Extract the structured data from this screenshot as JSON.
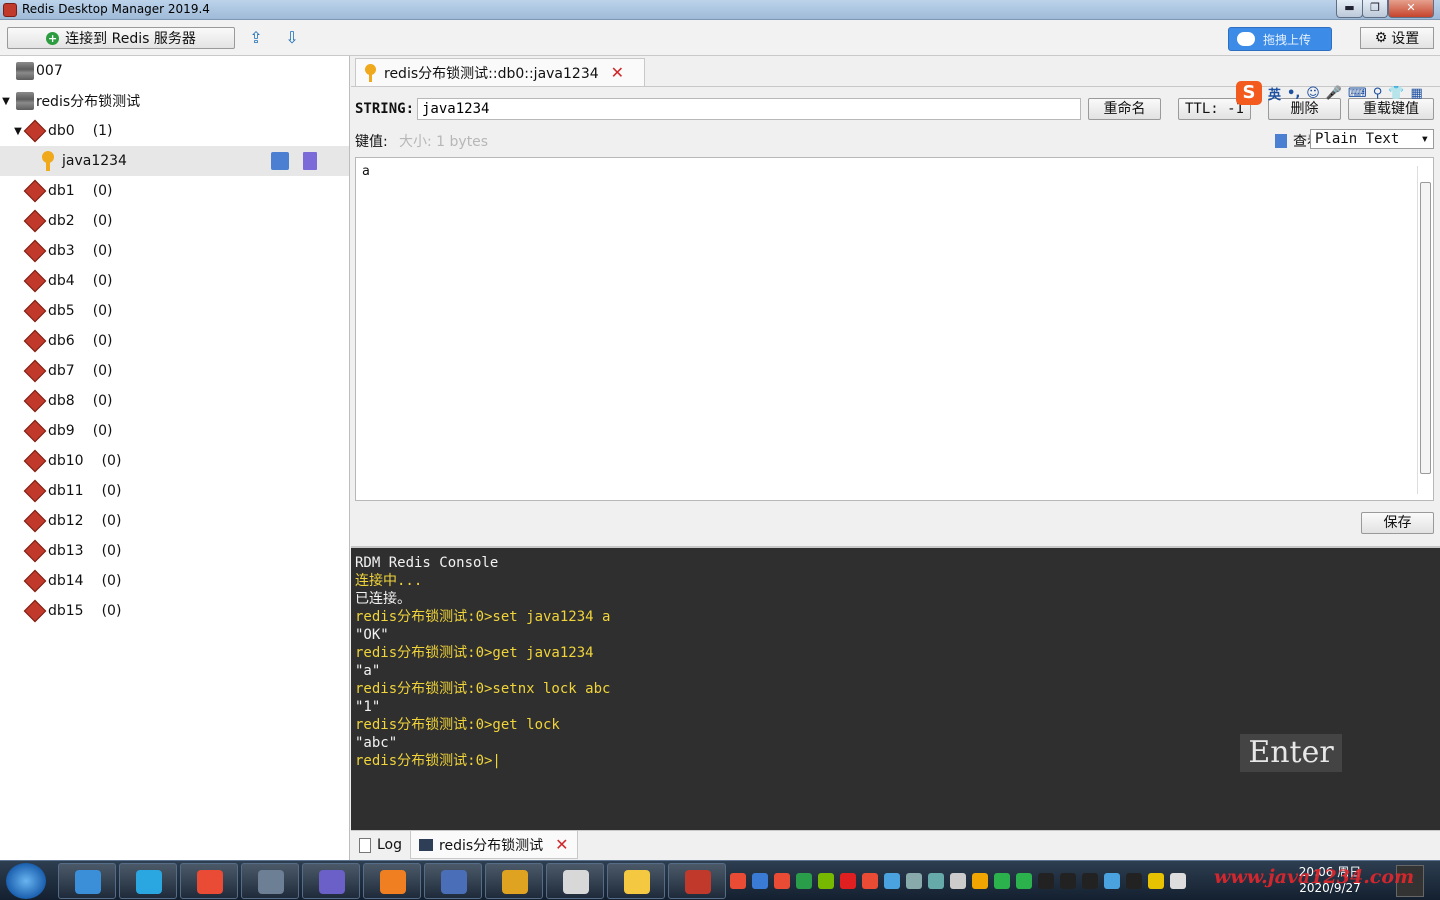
{
  "window": {
    "title": "Redis Desktop Manager 2019.4",
    "min_glyph": "▬",
    "max_glyph": "❐",
    "close_glyph": "✕"
  },
  "toolbar": {
    "connect_label": "连接到 Redis 服务器",
    "connect_glyph": "+",
    "import_glyph": "⇪",
    "export_glyph": "⇩",
    "upload_label": "拖拽上传",
    "settings_label": "设置",
    "settings_glyph": "⚙"
  },
  "tree": {
    "servers": [
      {
        "name": "007"
      },
      {
        "name": "redis分布锁测试",
        "arrow": "▼"
      }
    ],
    "databases": [
      {
        "name": "db0",
        "count": "(1)",
        "arrow": "▼"
      },
      {
        "name": "db1",
        "count": "(0)"
      },
      {
        "name": "db2",
        "count": "(0)"
      },
      {
        "name": "db3",
        "count": "(0)"
      },
      {
        "name": "db4",
        "count": "(0)"
      },
      {
        "name": "db5",
        "count": "(0)"
      },
      {
        "name": "db6",
        "count": "(0)"
      },
      {
        "name": "db7",
        "count": "(0)"
      },
      {
        "name": "db8",
        "count": "(0)"
      },
      {
        "name": "db9",
        "count": "(0)"
      },
      {
        "name": "db10",
        "count": "(0)"
      },
      {
        "name": "db11",
        "count": "(0)"
      },
      {
        "name": "db12",
        "count": "(0)"
      },
      {
        "name": "db13",
        "count": "(0)"
      },
      {
        "name": "db14",
        "count": "(0)"
      },
      {
        "name": "db15",
        "count": "(0)"
      }
    ],
    "key": {
      "name": "java1234"
    }
  },
  "editor": {
    "tab_label": "redis分布锁测试::db0::java1234",
    "type_label": "STRING:",
    "key_name": "java1234",
    "rename_label": "重命名",
    "ttl_label": "TTL: -1",
    "delete_label": "删除",
    "reload_label": "重载键值",
    "value_label": "键值:",
    "size_label": "大小: 1 bytes",
    "view_label": "查看",
    "view_mode": "Plain Text",
    "dropdown_glyph": "▾",
    "value": "a",
    "save_label": "保存"
  },
  "ime": {
    "logo": "S",
    "mode": "英",
    "punct": "•,",
    "icons": [
      "☺",
      "🎤",
      "⌨",
      "⚲",
      "👕",
      "▦"
    ]
  },
  "console": {
    "lines": [
      {
        "text": "RDM Redis Console",
        "style": "white"
      },
      {
        "text": "连接中...",
        "style": "yellow"
      },
      {
        "text": "已连接。",
        "style": "white"
      },
      {
        "text": "redis分布锁测试:0>set java1234 a",
        "style": "yellow"
      },
      {
        "text": "\"OK\"",
        "style": "white"
      },
      {
        "text": "redis分布锁测试:0>get java1234",
        "style": "yellow"
      },
      {
        "text": "\"a\"",
        "style": "white"
      },
      {
        "text": "redis分布锁测试:0>setnx lock abc",
        "style": "yellow"
      },
      {
        "text": "\"1\"",
        "style": "white"
      },
      {
        "text": "redis分布锁测试:0>get lock",
        "style": "yellow"
      },
      {
        "text": "\"abc\"",
        "style": "white"
      },
      {
        "text": "redis分布锁测试:0>|",
        "style": "yellow"
      }
    ],
    "key_overlay": "Enter"
  },
  "bottom_tabs": [
    {
      "label": "Log"
    },
    {
      "label": "redis分布锁测试",
      "closable": true
    }
  ],
  "taskbar": {
    "time": "20:06 周日",
    "date": "2020/9/27",
    "watermark": "www.java1234.com",
    "apps_colors": [
      "#3b8fd8",
      "#2aa6e0",
      "#e94b35",
      "#6d7f95",
      "#6b5fc8",
      "#f07f22",
      "#4a6fb8",
      "#e0a321",
      "#d8d8d8",
      "#f5c842",
      "#c0392b"
    ],
    "tray_colors": [
      "#e94b35",
      "#3a7bd5",
      "#e94b35",
      "#2a9d4a",
      "#76b900",
      "#e02020",
      "#e94b35",
      "#4aa3df",
      "#8aa",
      "#6aa",
      "#ccc",
      "#f0a500",
      "#2bb24c",
      "#2bb24c",
      "#222",
      "#222",
      "#222",
      "#4aa3df",
      "#222",
      "#e6c200",
      "#ddd"
    ]
  }
}
